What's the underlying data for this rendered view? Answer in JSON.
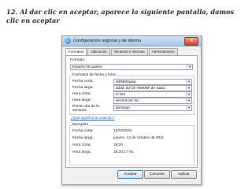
{
  "heading": "12. Al dar clic en aceptar, aparece la siguiente pantalla, damos clic en aceptar",
  "dialog": {
    "title": "Configuración regional y de idioma",
    "tabs": [
      "Formatos",
      "Ubicación",
      "Teclados e idiomas",
      "Administrativo"
    ],
    "format_label": "Formato:",
    "format_value": "Español (Ecuador)",
    "datetime_section": "Formatos de fecha y hora",
    "rows": [
      {
        "label": "Fecha corta:",
        "value": "dd/MM/aaaa"
      },
      {
        "label": "Fecha larga:",
        "value": "dddd, dd' de 'MMMM' de 'aaaa"
      },
      {
        "label": "Hora corta:",
        "value": "H:mm"
      },
      {
        "label": "Hora larga:",
        "value": "HH:mm:ss' hs.'"
      },
      {
        "label": "Primer día de la semana:",
        "value": "domingo"
      }
    ],
    "help_link": "¿Qué significa la notación?",
    "examples_section": "Ejemplos",
    "examples": [
      {
        "label": "Fecha corta:",
        "value": "13/10/2011"
      },
      {
        "label": "Fecha larga:",
        "value": "jueves, 13 de octubre de 2011"
      },
      {
        "label": "Hora corta:",
        "value": "18:20"
      },
      {
        "label": "Hora larga:",
        "value": "18:20:17 hs."
      }
    ],
    "buttons": {
      "ok": "Aceptar",
      "cancel": "Cancelar",
      "apply": "Aplicar"
    },
    "close_glyph": "✕",
    "dropdown_glyph": "▼"
  },
  "colors": {
    "titlebar": "#a9c7e8",
    "link": "#1a5fb4",
    "close": "#c9462b"
  }
}
